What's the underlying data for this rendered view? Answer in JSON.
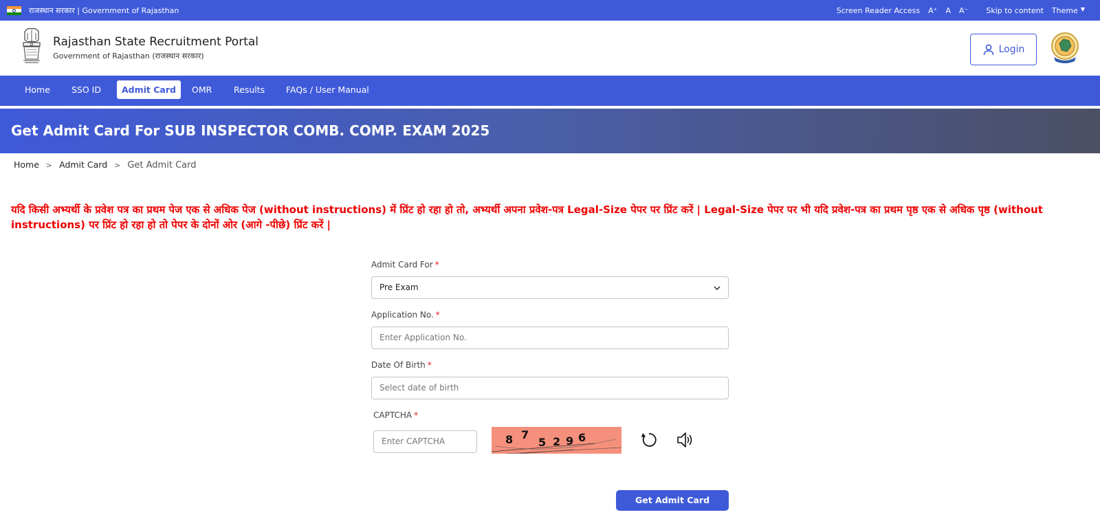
{
  "topbar": {
    "gov_label": "राजस्थान सरकार | Government of Rajasthan",
    "screen_reader": "Screen Reader Access",
    "font_increase": "A⁺",
    "font_normal": "A",
    "font_decrease": "A⁻",
    "skip": "Skip to content",
    "theme": "Theme",
    "theme_caret": "▼"
  },
  "header": {
    "title": "Rajasthan State Recruitment Portal",
    "subtitle": "Government of Rajasthan (राजस्थान सरकार)",
    "login_label": "Login"
  },
  "nav": {
    "items": [
      "Home",
      "SSO ID",
      "Admit Card",
      "OMR",
      "Results",
      "FAQs / User Manual"
    ],
    "active": "Admit Card"
  },
  "banner": {
    "title": "Get Admit Card For SUB INSPECTOR COMB. COMP. EXAM 2025"
  },
  "breadcrumb": {
    "home": "Home",
    "admit": "Admit Card",
    "current": "Get Admit Card",
    "sep": ">"
  },
  "notice": "यदि किसी अभ्यर्थी के प्रवेश पत्र का प्रथम पेज एक से अधिक पेज (without instructions) में प्रिंट हो रहा हो तो, अभ्यर्थी अपना प्रवेश-पत्र Legal-Size पेपर पर प्रिंट करें | Legal-Size पेपर पर भी यदि प्रवेश-पत्र का प्रथम पृष्ठ एक से अधिक पृष्ठ (without instructions) पर प्रिंट हो रहा हो तो पेपर के दोनों ओर (आगे -पीछे) प्रिंट करें |",
  "form": {
    "admit_for_label": "Admit Card For",
    "admit_for_value": "Pre Exam",
    "application_label": "Application No.",
    "application_placeholder": "Enter Application No.",
    "dob_label": "Date Of Birth",
    "dob_placeholder": "Select date of birth",
    "captcha_label": "CAPTCHA",
    "captcha_placeholder": "Enter CAPTCHA",
    "captcha_digits": [
      "8",
      "7",
      "5",
      "2",
      "9",
      "6"
    ],
    "required_mark": "*",
    "submit_label": "Get Admit Card"
  },
  "colors": {
    "primary": "#3f5ad9",
    "notice": "#ee0000",
    "captcha_bg": "#f5907c"
  },
  "icons": [
    "india-flag-icon",
    "ashoka-emblem-icon",
    "user-icon",
    "rajasthan-logo-icon",
    "chevron-down-icon",
    "refresh-icon",
    "speaker-icon"
  ]
}
